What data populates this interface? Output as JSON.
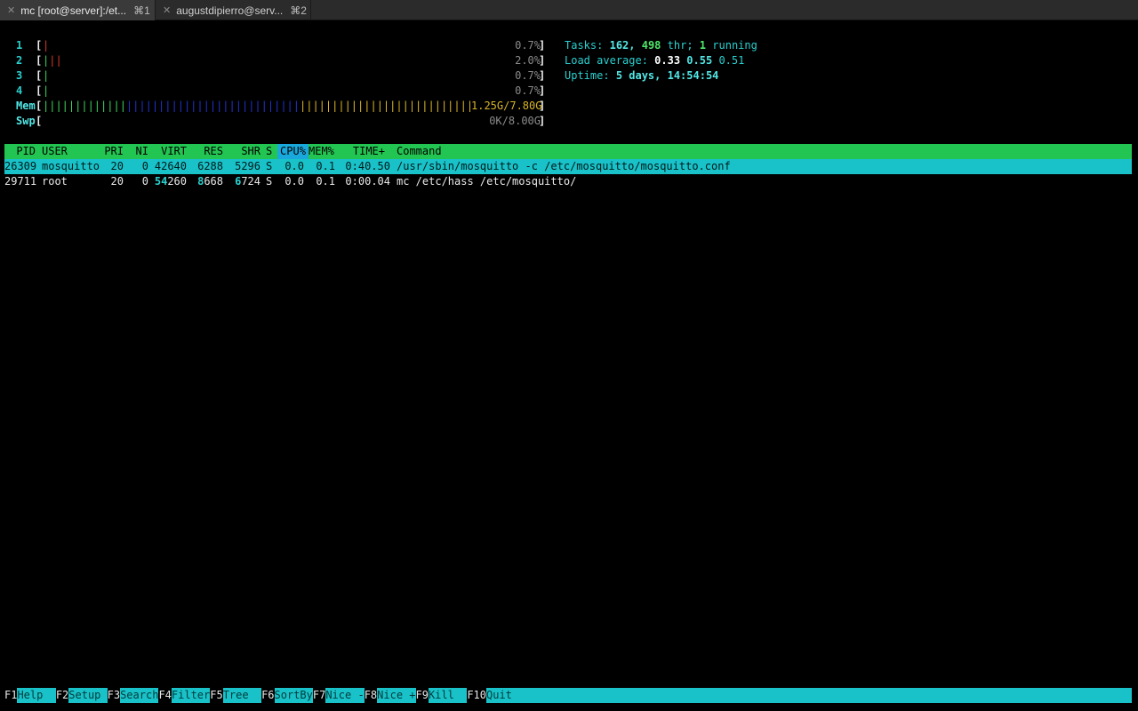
{
  "tabs": [
    {
      "title": "mc [root@server]:/et...",
      "shortcut": "⌘1",
      "active": true
    },
    {
      "title": "augustdipierro@serv...",
      "shortcut": "⌘2",
      "active": false
    }
  ],
  "cpus": [
    {
      "num": "1",
      "pct": "0.7%"
    },
    {
      "num": "2",
      "pct": "2.0%"
    },
    {
      "num": "3",
      "pct": "0.7%"
    },
    {
      "num": "4",
      "pct": "0.7%"
    }
  ],
  "mem": {
    "label": "Mem",
    "value": "1.25G/7.80G"
  },
  "swp": {
    "label": "Swp",
    "value": "0K/8.00G"
  },
  "stats": {
    "tasks_label": "Tasks:",
    "tasks": "162,",
    "threads": "498",
    "thr_label": "thr;",
    "running": "1",
    "running_label": "running",
    "load_label": "Load average:",
    "load1": "0.33",
    "load5": "0.55",
    "load15": "0.51",
    "uptime_label": "Uptime:",
    "uptime": "5 days, 14:54:54"
  },
  "columns": {
    "pid": "PID",
    "user": "USER",
    "pri": "PRI",
    "ni": "NI",
    "virt": "VIRT",
    "res": "RES",
    "shr": "SHR",
    "s": "S",
    "cpu": "CPU%",
    "mem": "MEM%",
    "time": "TIME+",
    "command": "Command"
  },
  "processes": [
    {
      "pid": "26309",
      "user": "mosquitto",
      "pri": "20",
      "ni": "0",
      "virt": "42640",
      "res": "6288",
      "shr": "5296",
      "s": "S",
      "cpu": "0.0",
      "mem": "0.1",
      "time": "0:40.50",
      "command": "/usr/sbin/mosquitto -c /etc/mosquitto/mosquitto.conf"
    },
    {
      "pid": "29711",
      "user": "root",
      "pri": "20",
      "ni": "0",
      "virt_hi": "54",
      "virt_lo": "260",
      "res_hi": "8",
      "res_lo": "668",
      "shr_hi": "6",
      "shr_lo": "724",
      "s": "S",
      "cpu": "0.0",
      "mem": "0.1",
      "time": "0:00.04",
      "command": "mc /etc/hass /etc/mosquitto/"
    }
  ],
  "fkeys": [
    {
      "key": "F1",
      "label": "Help  "
    },
    {
      "key": "F2",
      "label": "Setup "
    },
    {
      "key": "F3",
      "label": "Search"
    },
    {
      "key": "F4",
      "label": "Filter"
    },
    {
      "key": "F5",
      "label": "Tree  "
    },
    {
      "key": "F6",
      "label": "SortBy"
    },
    {
      "key": "F7",
      "label": "Nice -"
    },
    {
      "key": "F8",
      "label": "Nice +"
    },
    {
      "key": "F9",
      "label": "Kill  "
    },
    {
      "key": "F10",
      "label": "Quit"
    }
  ],
  "colors": {
    "header": "#23c552",
    "selected_row": "#19c2c8",
    "accent": "#2ad0d0"
  }
}
